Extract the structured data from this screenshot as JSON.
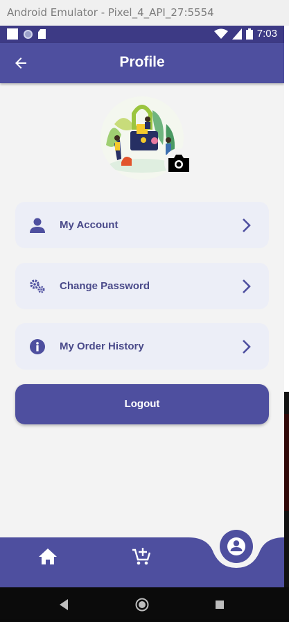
{
  "window": {
    "title": "Android Emulator - Pixel_4_API_27:5554"
  },
  "status_bar": {
    "time": "7:03"
  },
  "app_bar": {
    "title": "Profile",
    "back_icon": "arrow-left-icon"
  },
  "profile": {
    "avatar_icon": "avatar-illustration",
    "camera_icon": "camera-icon"
  },
  "menu": [
    {
      "label": "My Account",
      "icon": "person-icon"
    },
    {
      "label": "Change Password",
      "icon": "gears-icon"
    },
    {
      "label": "My Order History",
      "icon": "info-icon"
    }
  ],
  "logout": {
    "label": "Logout"
  },
  "bottom_nav": {
    "items": [
      "home-icon",
      "cart-add-icon",
      "profile-icon"
    ],
    "active": "profile-icon"
  },
  "colors": {
    "primary": "#4e4f9f",
    "statusbar": "#3d3a85",
    "menu_bg": "#eceef7",
    "text": "#4a4a8a"
  }
}
